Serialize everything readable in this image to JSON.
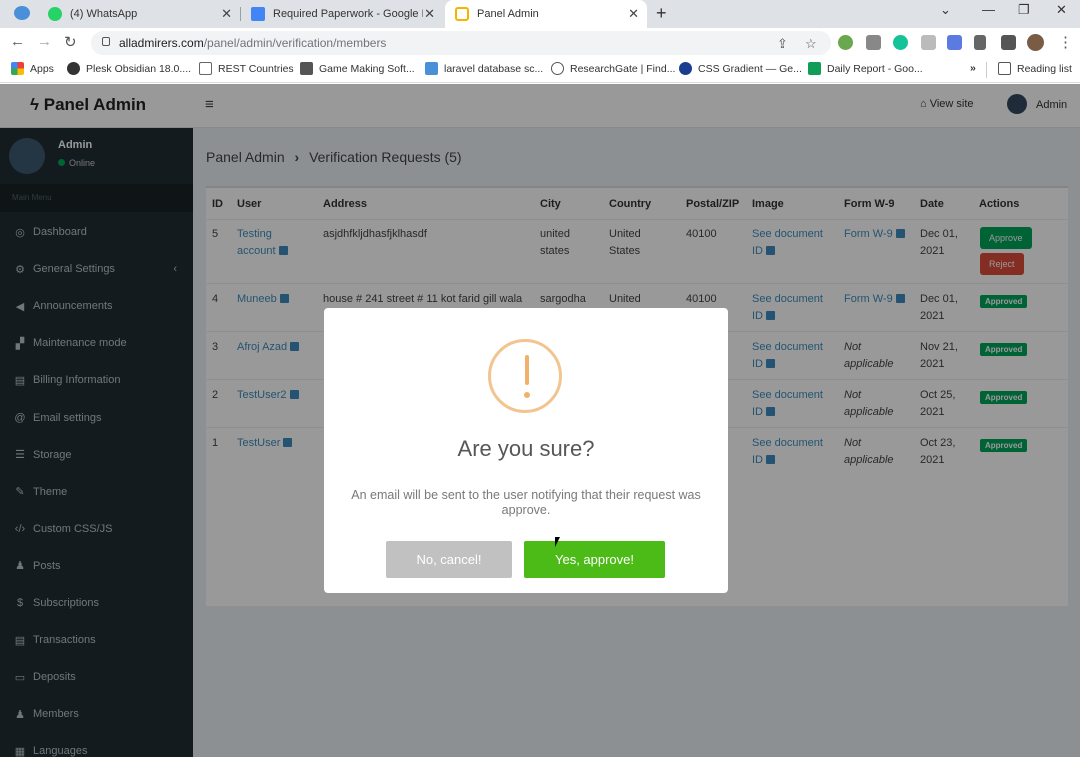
{
  "browser": {
    "tabs": [
      {
        "label": "(4) WhatsApp",
        "color": "#25d366"
      },
      {
        "label": "Required Paperwork - Google Dr",
        "color": "#4285f4"
      },
      {
        "label": "Panel Admin",
        "color": "#f4b400"
      }
    ],
    "url_host": "alladmirers.com",
    "url_path": "/panel/admin/verification/members",
    "bookmarks": [
      {
        "label": "Apps",
        "color": "#ea4335"
      },
      {
        "label": "Plesk Obsidian 18.0....",
        "color": "#333333"
      },
      {
        "label": "REST Countries",
        "color": "#444444"
      },
      {
        "label": "Game Making Soft...",
        "color": "#555555"
      },
      {
        "label": "laravel database sc...",
        "color": "#4a90d9"
      },
      {
        "label": "ResearchGate | Find...",
        "color": "#555555"
      },
      {
        "label": "CSS Gradient — Ge...",
        "color": "#1a73e8"
      },
      {
        "label": "Daily Report - Goo...",
        "color": "#0f9d58"
      }
    ],
    "bookmarks_more": "»",
    "reading_list": "Reading list"
  },
  "header": {
    "brand": "Panel Admin",
    "view_site": "View site",
    "admin_label": "Admin"
  },
  "sidebar": {
    "profile_name": "Admin",
    "profile_status": "Online",
    "section_label": "Main Menu",
    "items": [
      {
        "label": "Dashboard",
        "icon": "dashboard-icon",
        "glyph": "◎"
      },
      {
        "label": "General Settings",
        "icon": "cogs-icon",
        "glyph": "⚙",
        "chevron": "‹"
      },
      {
        "label": "Announcements",
        "icon": "bullhorn-icon",
        "glyph": "◀"
      },
      {
        "label": "Maintenance mode",
        "icon": "paint-roller-icon",
        "glyph": "▞"
      },
      {
        "label": "Billing Information",
        "icon": "file-icon",
        "glyph": "▤"
      },
      {
        "label": "Email settings",
        "icon": "at-icon",
        "glyph": "@"
      },
      {
        "label": "Storage",
        "icon": "database-icon",
        "glyph": "☰"
      },
      {
        "label": "Theme",
        "icon": "brush-icon",
        "glyph": "✎"
      },
      {
        "label": "Custom CSS/JS",
        "icon": "code-icon",
        "glyph": "‹/›"
      },
      {
        "label": "Posts",
        "icon": "users-icon",
        "glyph": "♟"
      },
      {
        "label": "Subscriptions",
        "icon": "dollar-icon",
        "glyph": "$"
      },
      {
        "label": "Transactions",
        "icon": "receipt-icon",
        "glyph": "▤"
      },
      {
        "label": "Deposits",
        "icon": "money-icon",
        "glyph": "▭"
      },
      {
        "label": "Members",
        "icon": "user-icon",
        "glyph": "♟"
      },
      {
        "label": "Languages",
        "icon": "language-icon",
        "glyph": "▦"
      }
    ]
  },
  "breadcrumb": {
    "root": "Panel Admin",
    "separator": "›",
    "current": "Verification Requests (5)"
  },
  "table": {
    "headers": [
      "ID",
      "User",
      "Address",
      "City",
      "Country",
      "Postal/ZIP",
      "Image",
      "Form W-9",
      "Date",
      "Actions"
    ],
    "rows": [
      {
        "id": "5",
        "user_l1": "Testing",
        "user_l2": "account",
        "address": "asjdhfkljdhasfjklhasdf",
        "city_l1": "united",
        "city_l2": "states",
        "country_l1": "United",
        "country_l2": "States",
        "zip": "40100",
        "img_l1": "See document",
        "img_l2": "ID",
        "w9": "Form W-9",
        "date_l1": "Dec 01,",
        "date_l2": "2021",
        "approve": "Approve",
        "reject": "Reject"
      },
      {
        "id": "4",
        "user_l1": "Muneeb",
        "address": "house # 241 street # 11 kot farid gill wala",
        "city_l1": "sargodha",
        "country_l1": "United",
        "zip": "40100",
        "img_l1": "See document",
        "img_l2": "ID",
        "w9": "Form W-9",
        "date_l1": "Dec 01,",
        "date_l2": "2021",
        "status": "Approved"
      },
      {
        "id": "3",
        "user_l1": "Afroj Azad",
        "img_l1": "See document",
        "img_l2": "ID",
        "w9_l1": "Not",
        "w9_l2": "applicable",
        "date_l1": "Nov 21,",
        "date_l2": "2021",
        "status": "Approved"
      },
      {
        "id": "2",
        "user_l1": "TestUser2",
        "img_l1": "See document",
        "img_l2": "ID",
        "w9_l1": "Not",
        "w9_l2": "applicable",
        "date_l1": "Oct 25,",
        "date_l2": "2021",
        "status": "Approved"
      },
      {
        "id": "1",
        "user_l1": "TestUser",
        "img_l1": "See document",
        "img_l2": "ID",
        "w9_l1": "Not",
        "w9_l2": "applicable",
        "date_l1": "Oct 23,",
        "date_l2": "2021",
        "status": "Approved"
      }
    ]
  },
  "modal": {
    "title": "Are you sure?",
    "text": "An email will be sent to the user notifying that their request was approve.",
    "cancel_label": "No, cancel!",
    "confirm_label": "Yes, approve!"
  },
  "colors": {
    "sidebar_bg": "#222d32",
    "approve_green": "#00a65a",
    "reject_red": "#dd4b39",
    "confirm_green": "#4cbb17",
    "link_blue": "#3c8dbc",
    "warning_orange": "#f2b16a"
  }
}
